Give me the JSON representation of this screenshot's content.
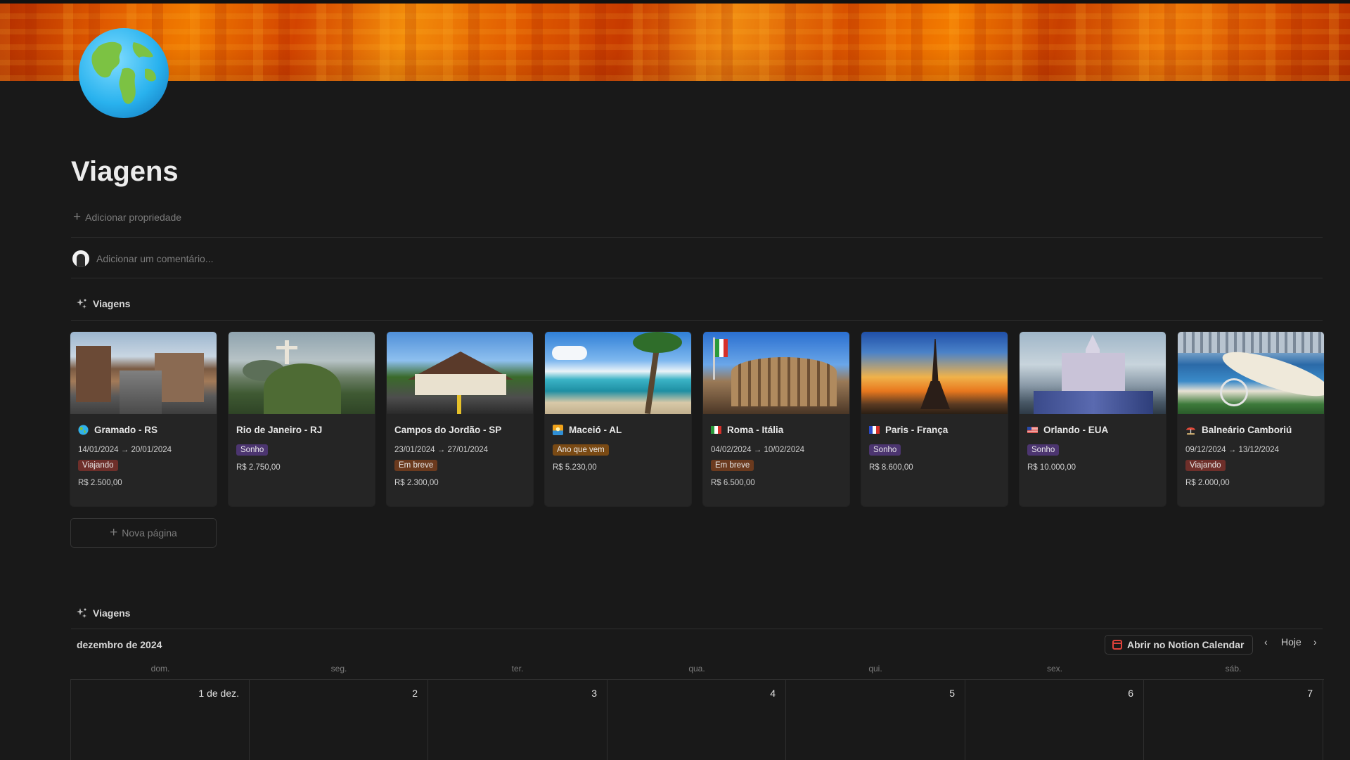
{
  "page": {
    "title": "Viagens",
    "add_property": "Adicionar propriedade",
    "comment_placeholder": "Adicionar um comentário..."
  },
  "gallery": {
    "heading": "Viagens",
    "new_page": "Nova página",
    "cards": [
      {
        "title": "Gramado - RS",
        "icon": "globe-icon",
        "date": "14/01/2024 → 20/01/2024",
        "tag": "Viajando",
        "tag_color": "#6e2f2a",
        "price": "R$ 2.500,00",
        "image": "gramado-street-image"
      },
      {
        "title": "Rio de Janeiro - RJ",
        "icon": "",
        "date": "",
        "tag": "Sonho",
        "tag_color": "#4c3570",
        "price": "R$ 2.750,00",
        "image": "christ-redeemer-image"
      },
      {
        "title": "Campos do Jordão - SP",
        "icon": "",
        "date": "23/01/2024 → 27/01/2024",
        "tag": "Em breve",
        "tag_color": "#6b3a1e",
        "price": "R$ 2.300,00",
        "image": "campos-portal-image"
      },
      {
        "title": "Maceió - AL",
        "icon": "beach-flag-icon",
        "date": "",
        "tag": "Ano que vem",
        "tag_color": "#7a4a14",
        "price": "R$ 5.230,00",
        "image": "maceio-beach-image"
      },
      {
        "title": "Roma - Itália",
        "icon": "italy-flag-icon",
        "date": "04/02/2024 → 10/02/2024",
        "tag": "Em breve",
        "tag_color": "#6b3a1e",
        "price": "R$ 6.500,00",
        "image": "colosseum-image"
      },
      {
        "title": "Paris - França",
        "icon": "france-flag-icon",
        "date": "",
        "tag": "Sonho",
        "tag_color": "#4c3570",
        "price": "R$ 8.600,00",
        "image": "eiffel-tower-image"
      },
      {
        "title": "Orlando - EUA",
        "icon": "usa-flag-icon",
        "date": "",
        "tag": "Sonho",
        "tag_color": "#4c3570",
        "price": "R$ 10.000,00",
        "image": "disney-castle-image"
      },
      {
        "title": "Balneário Camboriú",
        "icon": "beach-umbrella-icon",
        "date": "09/12/2024 → 13/12/2024",
        "tag": "Viajando",
        "tag_color": "#6e2f2a",
        "price": "R$ 2.000,00",
        "image": "camboriu-coast-image"
      }
    ]
  },
  "calendar": {
    "heading": "Viagens",
    "month": "dezembro de 2024",
    "open_button": "Abrir no Notion Calendar",
    "today": "Hoje",
    "prev": "‹",
    "next": "›",
    "weekdays": [
      "dom.",
      "seg.",
      "ter.",
      "qua.",
      "qui.",
      "sex.",
      "sáb."
    ],
    "days": [
      "1 de dez.",
      "2",
      "3",
      "4",
      "5",
      "6",
      "7"
    ]
  },
  "colors": {
    "background": "#191919",
    "card": "#252525",
    "text": "#e6e6e6",
    "muted": "#7c7c7c"
  }
}
